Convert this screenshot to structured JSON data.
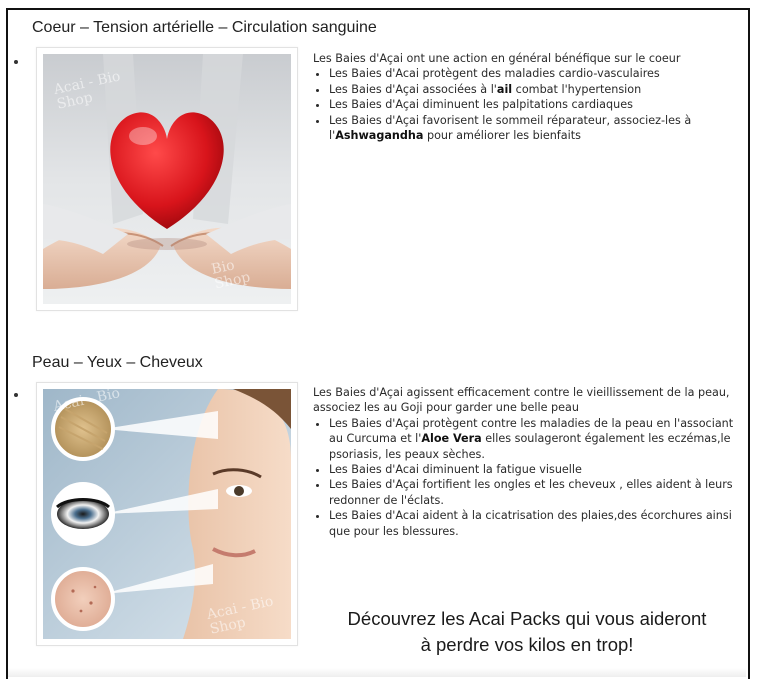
{
  "sections": [
    {
      "title": "Coeur – Tension artérielle – Circulation sanguine",
      "image": {
        "icon": "heart-in-hands-photo",
        "watermark_top": "Acai - Bio\nShop",
        "watermark_bottom": "Bio\nShop"
      },
      "paragraphs": [
        "Les Baies d'Açai ont une action en général bénéfique sur le coeur"
      ],
      "items": [
        {
          "before": "Les Baies d'Acai protègent des maladies cardio-vasculaires",
          "bold": "",
          "after": ""
        },
        {
          "before": "Les Baies d'Açai associées à l'",
          "bold": "ail",
          "after": " combat l'hypertension"
        },
        {
          "before": "Les Baies d'Açai diminuent les palpitations cardiaques",
          "bold": "",
          "after": ""
        },
        {
          "before": "Les Baies d'Açai favorisent le sommeil réparateur, associez-les à l'",
          "bold": "Ashwagandha",
          "after": " pour améliorer les bienfaits"
        }
      ]
    },
    {
      "title": "Peau – Yeux – Cheveux",
      "image": {
        "icon": "face-hair-eye-skin-photo",
        "watermark_top": "Acai - Bio",
        "watermark_bottom": "Acai - Bio\nShop"
      },
      "paragraphs": [
        "Les Baies d'Açai agissent efficacement contre le vieillissement de la peau, associez les au Goji pour garder une belle peau"
      ],
      "items": [
        {
          "before": "Les Baies d'Açai protègent contre les maladies de la peau en l'associant au Curcuma et l'",
          "bold": "Aloe Vera",
          "after": " elles soulageront également les eczémas,le psoriasis, les peaux sèches."
        },
        {
          "before": "Les Baies d'Acai diminuent la fatigue visuelle",
          "bold": "",
          "after": ""
        },
        {
          "before": "Les Baies d'Açai fortifient les ongles et les cheveux , elles aident à leurs redonner de l'éclats.",
          "bold": "",
          "after": ""
        },
        {
          "before": "Les Baies d'Acai aident à la cicatrisation des plaies,des écorchures ainsi que pour les blessures.",
          "bold": "",
          "after": ""
        }
      ]
    }
  ],
  "cta": {
    "line1": "Découvrez les Acai Packs qui vous aideront",
    "line2": "à perdre vos kilos en trop!"
  }
}
